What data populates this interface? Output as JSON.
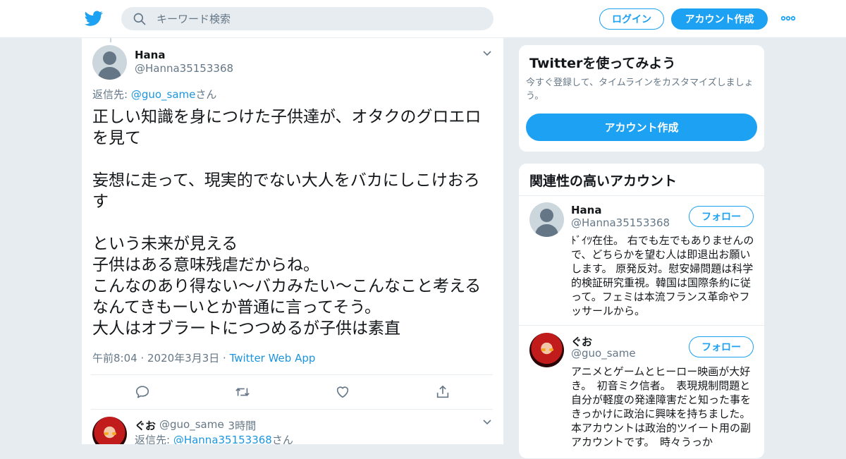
{
  "brand": {
    "accent": "#1da1f2",
    "link": "#1b95e0",
    "muted": "#657786"
  },
  "header": {
    "logo_icon": "twitter-bird-icon",
    "search_placeholder": "キーワード検索",
    "login_label": "ログイン",
    "signup_label": "アカウント作成",
    "more_icon": "more-dots-icon"
  },
  "tweet": {
    "name": "Hana",
    "handle": "@Hanna35153368",
    "reply_prefix": "返信先: ",
    "reply_link": "@guo_same",
    "reply_suffix": "さん",
    "text": "正しい知識を身につけた子供達が、オタクのグロエロを見て\n\n妄想に走って、現実的でない大人をバカにしこけおろす\n\nという未来が見える\n子供はある意味残虐だからね。\nこんなのあり得ない～バカみたい～こんなこと考えるなんてきもーいとか普通に言ってそう。\n大人はオブラートにつつめるが子供は素直",
    "time": "午前8:04 · 2020年3月3日 · ",
    "source": "Twitter Web App"
  },
  "reply_tweet": {
    "name": "ぐお",
    "handle": "@guo_same",
    "time": "· 3時間",
    "reply_prefix": "返信先: ",
    "reply_link": "@Hanna35153368",
    "reply_suffix": "さん"
  },
  "signup_card": {
    "title": "Twitterを使ってみよう",
    "subtitle": "今すぐ登録して、タイムラインをカスタマイズしましょう。",
    "button": "アカウント作成"
  },
  "related_card": {
    "title": "関連性の高いアカウント",
    "follow_label": "フォロー",
    "accounts": [
      {
        "name": "Hana",
        "handle": "@Hanna35153368",
        "bio": "ﾄﾞｲﾂ在住。 右でも左でもありませんので、どちらかを望む人は即退出お願いします。 原発反対。慰安婦問題は科学的検証研究重視。韓国は国際条約に従って。フェミは本流フランス革命やフッサールから。"
      },
      {
        "name": "ぐお",
        "handle": "@guo_same",
        "bio": "アニメとゲームとヒーロー映画が大好き。　初音ミク信者。　表現規制問題と自分が軽度の発達障害だと知った事をきっかけに政治に興味を持ちました。　本アカウントは政治的ツイート用の副アカウントです。　時々うっか"
      }
    ]
  }
}
